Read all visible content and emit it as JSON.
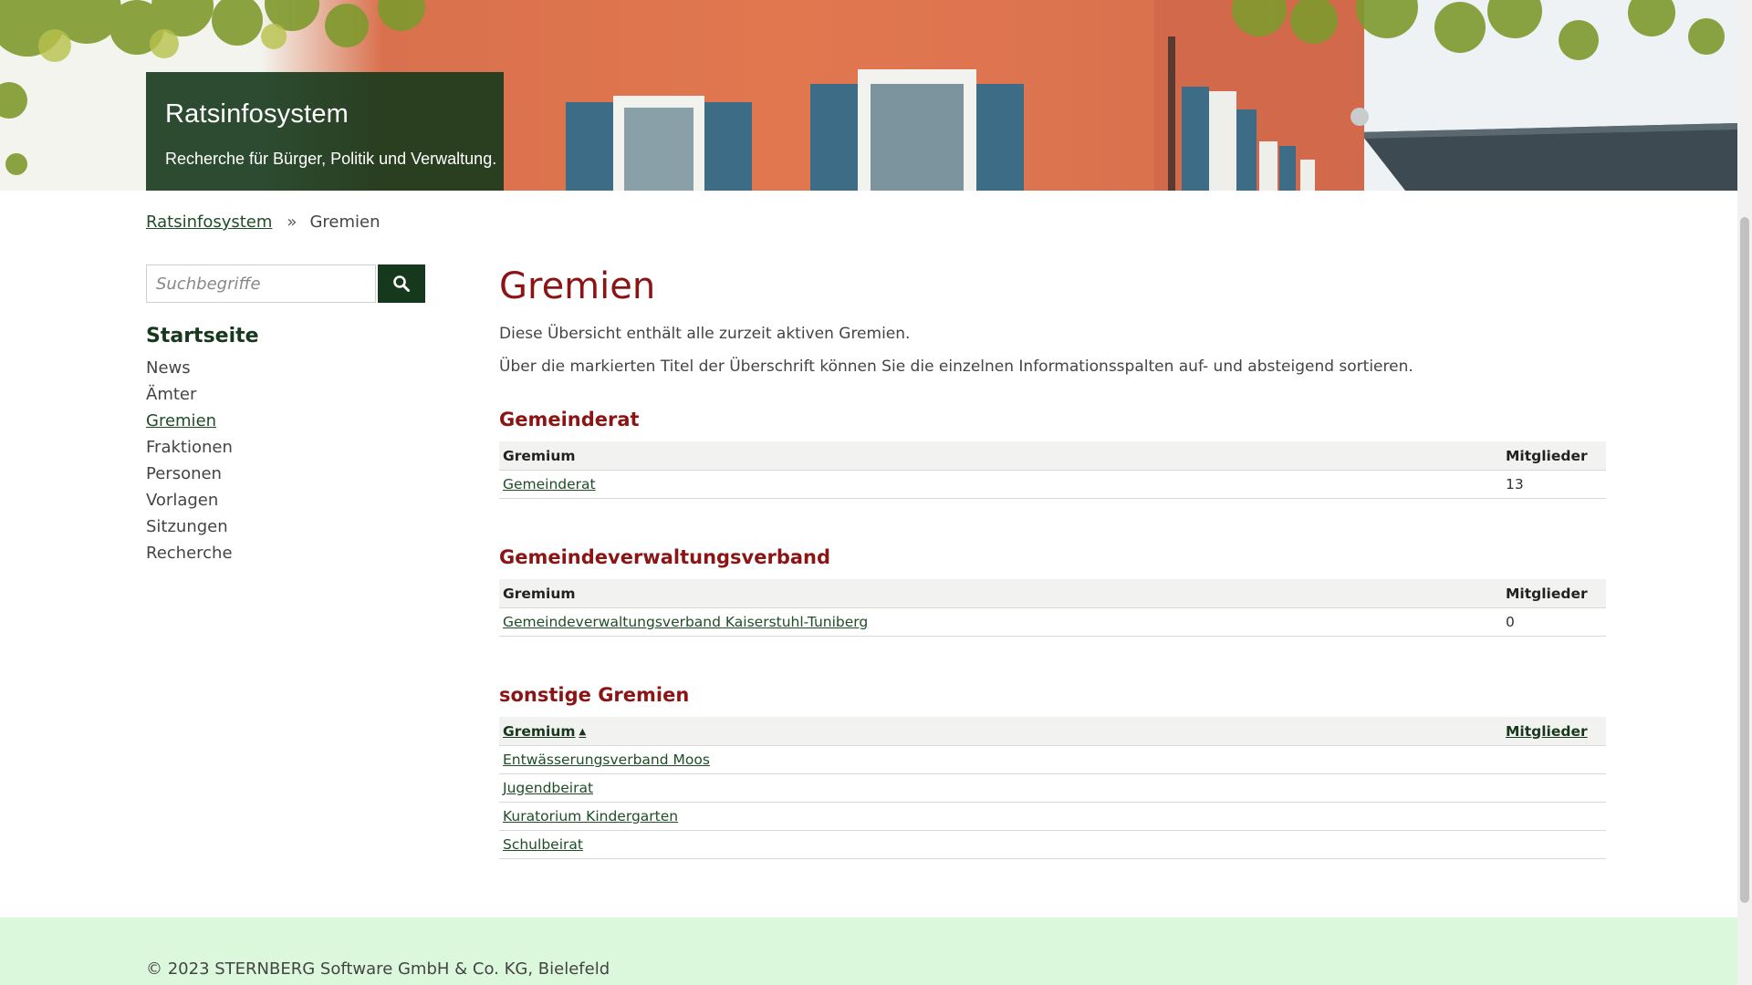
{
  "hero": {
    "title": "Ratsinfosystem",
    "subtitle": "Recherche für Bürger, Politik und Verwaltung."
  },
  "breadcrumb": {
    "items": [
      "Ratsinfosystem",
      "Gremien"
    ],
    "separator": "»"
  },
  "search": {
    "placeholder": "Suchbegriffe",
    "button_icon": "search-icon"
  },
  "nav": {
    "heading": "Startseite",
    "items": [
      "News",
      "Ämter",
      "Gremien",
      "Fraktionen",
      "Personen",
      "Vorlagen",
      "Sitzungen",
      "Recherche"
    ],
    "active": "Gremien"
  },
  "main": {
    "title": "Gremien",
    "intro1": "Diese Übersicht enthält alle zurzeit aktiven Gremien.",
    "intro2": "Über die markierten Titel der Überschrift können Sie die einzelnen Informationsspalten auf- und absteigend sortieren.",
    "sections": [
      {
        "title": "Gemeinderat",
        "col_gremium": "Gremium",
        "col_mitglieder": "Mitglieder",
        "rows": [
          {
            "name": "Gemeinderat",
            "members": "13"
          }
        ]
      },
      {
        "title": "Gemeindeverwaltungsverband",
        "col_gremium": "Gremium",
        "col_mitglieder": "Mitglieder",
        "rows": [
          {
            "name": "Gemeindeverwaltungsverband Kaiserstuhl-Tuniberg",
            "members": "0"
          }
        ]
      },
      {
        "title": "sonstige Gremien",
        "col_gremium": "Gremium",
        "col_mitglieder": "Mitglieder",
        "sort_indicator": "▲",
        "rows": [
          {
            "name": "Entwässerungsverband Moos",
            "members": ""
          },
          {
            "name": "Jugendbeirat",
            "members": ""
          },
          {
            "name": "Kuratorium Kindergarten",
            "members": ""
          },
          {
            "name": "Schulbeirat",
            "members": ""
          }
        ]
      }
    ]
  },
  "footer": {
    "text": "© 2023 STERNBERG Software GmbH & Co. KG, Bielefeld"
  },
  "colors": {
    "brand_dark_green": "#16381c",
    "heading_red": "#8b1414",
    "footer_bg": "#dcf8dc"
  }
}
